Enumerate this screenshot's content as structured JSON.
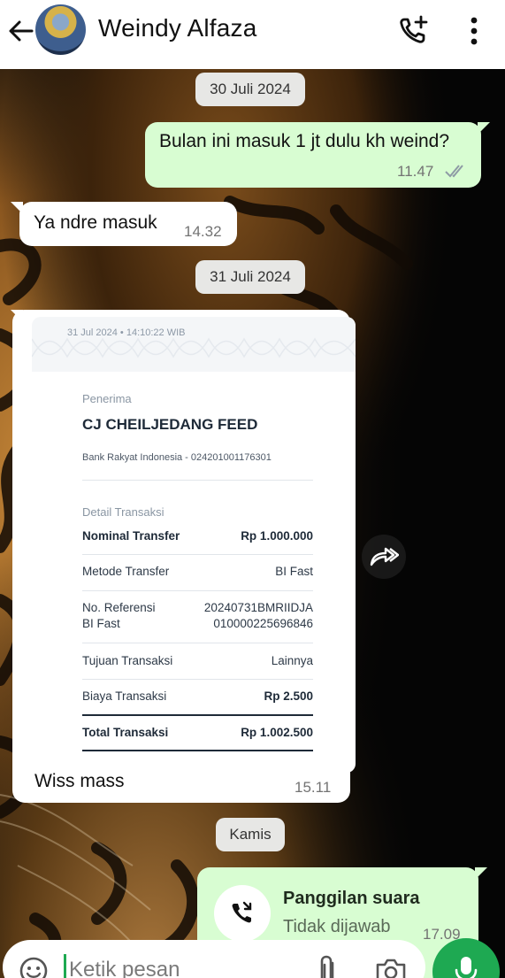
{
  "header": {
    "contact_name": "Weindy Alfaza",
    "icons": [
      "back-arrow-icon",
      "avatar",
      "add-call-icon",
      "more-vert-icon"
    ]
  },
  "messages": {
    "date1": "30 Juli 2024",
    "m1_text": "Bulan ini masuk 1 jt dulu kh weind?",
    "m1_time": "11.47",
    "m2_text": "Ya ndre masuk",
    "m2_time": "14.32",
    "date2": "31 Juli 2024",
    "m3_caption": "Wiss mass",
    "m3_time": "15.11",
    "date3": "Kamis",
    "call_title": "Panggilan suara",
    "call_status": "Tidak dijawab",
    "call_time": "17.09"
  },
  "receipt": {
    "timestamp": "31 Jul 2024 • 14:10:22 WIB",
    "recipient_label": "Penerima",
    "recipient_name": "CJ CHEILJEDANG FEED",
    "recipient_bank": "Bank Rakyat Indonesia - 024201001176301",
    "detail_label": "Detail Transaksi",
    "rows": [
      {
        "key": "Nominal Transfer",
        "value": "Rp 1.000.000"
      },
      {
        "key": "Metode Transfer",
        "value": "BI Fast"
      },
      {
        "key_line1": "No. Referensi",
        "key_line2": "BI Fast",
        "value_line1": "20240731BMRIIDJA",
        "value_line2": "010000225696846"
      },
      {
        "key": "Tujuan Transaksi",
        "value": "Lainnya"
      },
      {
        "key": "Biaya Transaksi",
        "value": "Rp 2.500"
      },
      {
        "key": "Total Transaksi",
        "value": "Rp 1.002.500"
      }
    ]
  },
  "input": {
    "placeholder": "Ketik pesan"
  },
  "colors": {
    "outgoing_bubble": "#d8fdd2",
    "incoming_bubble": "#ffffff",
    "read_ticks": "#8e9ba5",
    "mic_green": "#1ea952"
  }
}
